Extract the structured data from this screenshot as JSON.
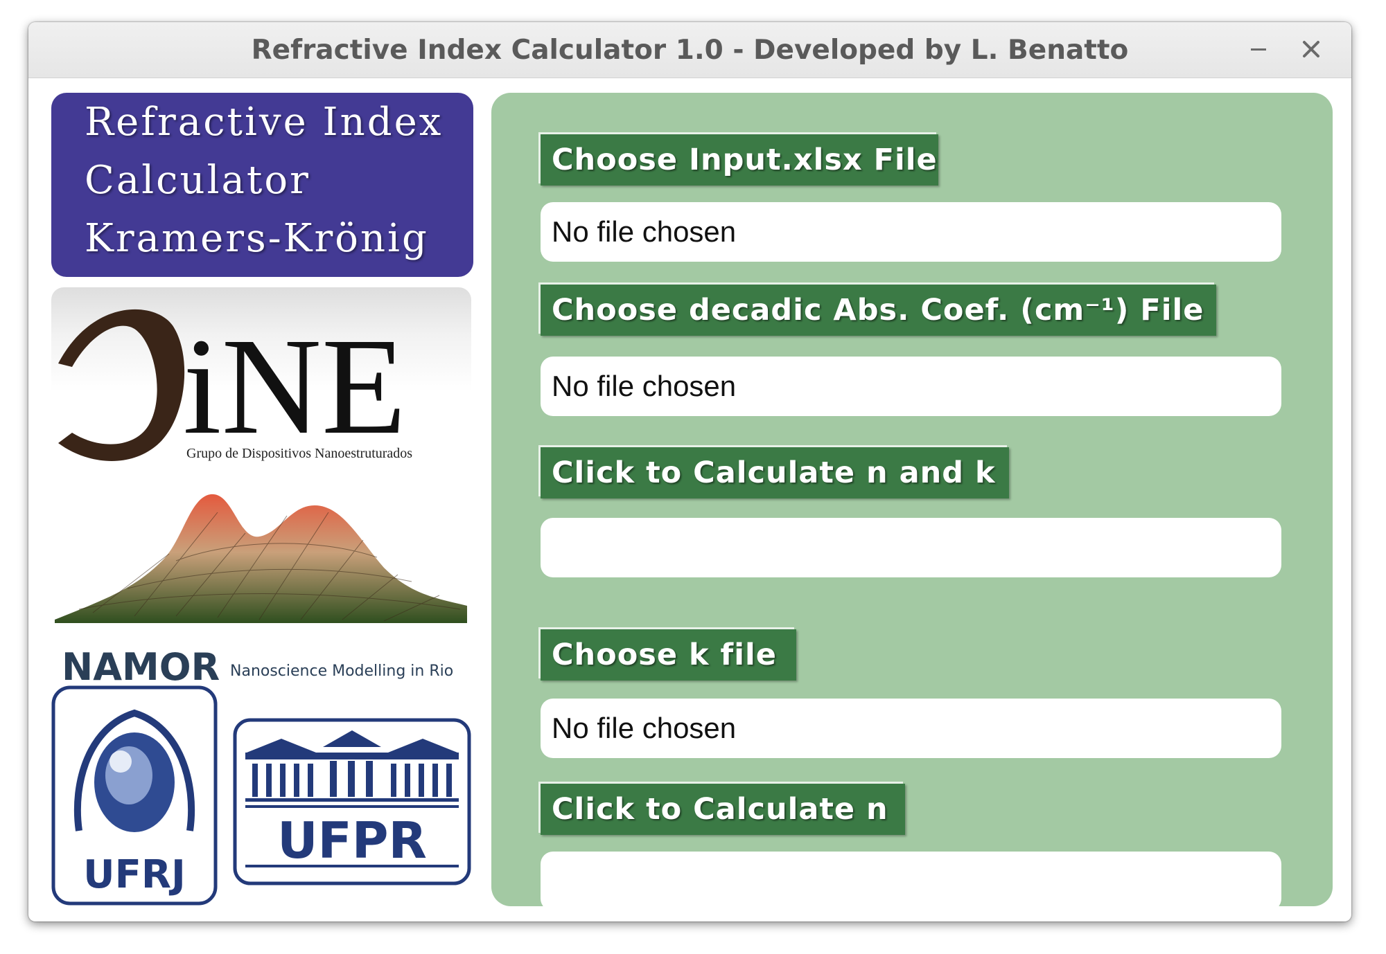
{
  "window": {
    "title": "Refractive Index Calculator 1.0 - Developed by L. Benatto"
  },
  "header_card": {
    "line1": "Refractive Index",
    "line2": "Calculator",
    "line3": "Kramers-Krönig"
  },
  "logos": {
    "gdne": {
      "wordmark": "iNE",
      "tagline": "Grupo de Dispositivos Nanoestruturados"
    },
    "namor": {
      "wordmark": "NAMOR",
      "tagline": "Nanoscience Modelling in Rio"
    },
    "ufrj": {
      "wordmark": "UFRJ"
    },
    "ufpr": {
      "wordmark": "UFPR"
    }
  },
  "panel": {
    "choose_input_label": "Choose Input.xlsx File",
    "input_file_status": "No file chosen",
    "choose_abs_label": "Choose decadic Abs. Coef. (cm⁻¹) File",
    "abs_file_status": "No file chosen",
    "calc_nk_label": "Click to Calculate n and k",
    "calc_nk_output": "",
    "choose_k_label": "Choose k file",
    "k_file_status": "No file chosen",
    "calc_n_label": "Click to Calculate n",
    "calc_n_output": ""
  },
  "colors": {
    "header_bg": "#433a94",
    "panel_bg": "#a3c9a3",
    "button_bg": "#3b7a45",
    "logo_navy": "#233a7a"
  }
}
